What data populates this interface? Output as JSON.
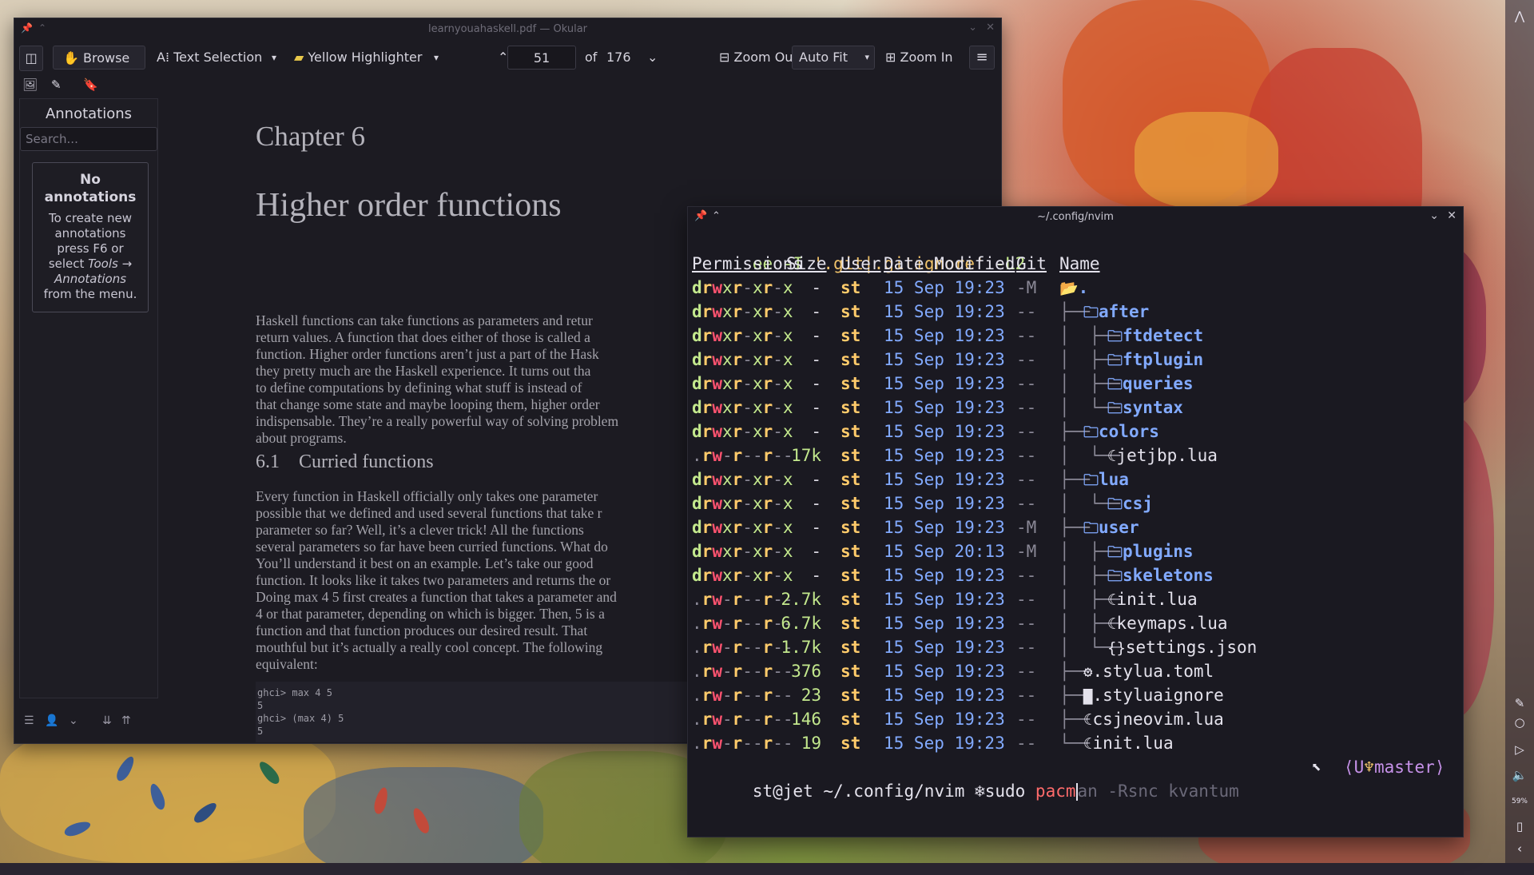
{
  "okular": {
    "title": "learnyouahaskell.pdf — Okular",
    "toolbar": {
      "browse": "Browse",
      "text_selection": "Text Selection",
      "highlighter": "Yellow Highlighter",
      "page_current": "51",
      "page_of": "of",
      "page_total": "176",
      "zoom_out": "Zoom Out",
      "zoom_mode": "Auto Fit",
      "zoom_in": "Zoom In"
    },
    "sidebar": {
      "heading": "Annotations",
      "search_placeholder": "Search...",
      "empty_title": "No annotations",
      "empty_line1": "To create new",
      "empty_line2": "annotations",
      "empty_line3": "press F6 or",
      "empty_line4_pre": "select ",
      "empty_line4_em": "Tools →",
      "empty_line5": "Annotations",
      "empty_line6": "from the menu."
    },
    "document": {
      "chapter": "Chapter 6",
      "title": "Higher order functions",
      "para1": [
        "Haskell functions can take functions as parameters and retur",
        "return values.  A function that does either of those is called a",
        "function. Higher order functions aren’t just a part of the Hask",
        "they pretty much are the Haskell experience.  It turns out tha",
        "to define computations by defining what stuff is instead of",
        "that change some state and maybe looping them, higher order",
        "indispensable. They’re a really powerful way of solving problem",
        "about programs."
      ],
      "section": "6.1    Curried functions",
      "para2": [
        "Every function in Haskell officially only takes one parameter",
        "possible that we defined and used several functions that take r",
        "parameter so far?  Well, it’s a clever trick!  All the functions",
        "several parameters so far have been curried functions.  What do",
        "You’ll understand it best on an example. Let’s take our good",
        "function. It looks like it takes two parameters and returns the or",
        "Doing max 4 5 first creates a function that takes a parameter and",
        "4 or that parameter, depending on which is bigger.  Then, 5 is a",
        "function and that function produces our desired result.  That",
        "mouthful but it’s actually a really cool concept.  The following",
        "equivalent:"
      ],
      "code": [
        "ghci> max 4 5",
        "5",
        "ghci> (max 4) 5",
        "5"
      ]
    }
  },
  "terminal": {
    "title": "~/.config/nvim",
    "command": {
      "prog": "ee",
      "flag1": "-I",
      "arg": "'.git|.gitignore'",
      "flag2": "-L2"
    },
    "headers": [
      "Permissions",
      "Size",
      "User",
      "Date Modified",
      "Git",
      "Name"
    ],
    "rows": [
      {
        "perm": "drwxr-xr-x",
        "size": "-",
        "user": "st",
        "date": "15 Sep 19:23",
        "git": "-M",
        "tree": "",
        "icon": "📂",
        "name": ".",
        "dir": true
      },
      {
        "perm": "drwxr-xr-x",
        "size": "-",
        "user": "st",
        "date": "15 Sep 19:23",
        "git": "--",
        "tree": "├──",
        "icon": "🗀",
        "name": "after",
        "dir": true
      },
      {
        "perm": "drwxr-xr-x",
        "size": "-",
        "user": "st",
        "date": "15 Sep 19:23",
        "git": "--",
        "tree": "│  ├──",
        "icon": "🗀",
        "name": "ftdetect",
        "dir": true
      },
      {
        "perm": "drwxr-xr-x",
        "size": "-",
        "user": "st",
        "date": "15 Sep 19:23",
        "git": "--",
        "tree": "│  ├──",
        "icon": "🗀",
        "name": "ftplugin",
        "dir": true
      },
      {
        "perm": "drwxr-xr-x",
        "size": "-",
        "user": "st",
        "date": "15 Sep 19:23",
        "git": "--",
        "tree": "│  ├──",
        "icon": "🗀",
        "name": "queries",
        "dir": true
      },
      {
        "perm": "drwxr-xr-x",
        "size": "-",
        "user": "st",
        "date": "15 Sep 19:23",
        "git": "--",
        "tree": "│  └──",
        "icon": "🗀",
        "name": "syntax",
        "dir": true
      },
      {
        "perm": "drwxr-xr-x",
        "size": "-",
        "user": "st",
        "date": "15 Sep 19:23",
        "git": "--",
        "tree": "├──",
        "icon": "🗀",
        "name": "colors",
        "dir": true
      },
      {
        "perm": ".rw-r--r--",
        "size": "17k",
        "user": "st",
        "date": "15 Sep 19:23",
        "git": "--",
        "tree": "│  └──",
        "icon": "☾",
        "name": "jetjbp.lua",
        "dir": false
      },
      {
        "perm": "drwxr-xr-x",
        "size": "-",
        "user": "st",
        "date": "15 Sep 19:23",
        "git": "--",
        "tree": "├──",
        "icon": "🗀",
        "name": "lua",
        "dir": true
      },
      {
        "perm": "drwxr-xr-x",
        "size": "-",
        "user": "st",
        "date": "15 Sep 19:23",
        "git": "--",
        "tree": "│  └──",
        "icon": "🗀",
        "name": "csj",
        "dir": true
      },
      {
        "perm": "drwxr-xr-x",
        "size": "-",
        "user": "st",
        "date": "15 Sep 19:23",
        "git": "-M",
        "tree": "├──",
        "icon": "🗀",
        "name": "user",
        "dir": true
      },
      {
        "perm": "drwxr-xr-x",
        "size": "-",
        "user": "st",
        "date": "15 Sep 20:13",
        "git": "-M",
        "tree": "│  ├──",
        "icon": "🗀",
        "name": "plugins",
        "dir": true
      },
      {
        "perm": "drwxr-xr-x",
        "size": "-",
        "user": "st",
        "date": "15 Sep 19:23",
        "git": "--",
        "tree": "│  ├──",
        "icon": "🗀",
        "name": "skeletons",
        "dir": true
      },
      {
        "perm": ".rw-r--r--",
        "size": "2.7k",
        "user": "st",
        "date": "15 Sep 19:23",
        "git": "--",
        "tree": "│  ├──",
        "icon": "☾",
        "name": "init.lua",
        "dir": false
      },
      {
        "perm": ".rw-r--r--",
        "size": "6.7k",
        "user": "st",
        "date": "15 Sep 19:23",
        "git": "--",
        "tree": "│  ├──",
        "icon": "☾",
        "name": "keymaps.lua",
        "dir": false
      },
      {
        "perm": ".rw-r--r--",
        "size": "1.7k",
        "user": "st",
        "date": "15 Sep 19:23",
        "git": "--",
        "tree": "│  └──",
        "icon": "{}",
        "name": "settings.json",
        "dir": false
      },
      {
        "perm": ".rw-r--r--",
        "size": "376",
        "user": "st",
        "date": "15 Sep 19:23",
        "git": "--",
        "tree": "├──",
        "icon": "⚙",
        "name": ".stylua.toml",
        "dir": false
      },
      {
        "perm": ".rw-r--r--",
        "size": "23",
        "user": "st",
        "date": "15 Sep 19:23",
        "git": "--",
        "tree": "├──",
        "icon": "▇",
        "name": ".styluaignore",
        "dir": false
      },
      {
        "perm": ".rw-r--r--",
        "size": "146",
        "user": "st",
        "date": "15 Sep 19:23",
        "git": "--",
        "tree": "├──",
        "icon": "☾",
        "name": "csjneovim.lua",
        "dir": false
      },
      {
        "perm": ".rw-r--r--",
        "size": "19",
        "user": "st",
        "date": "15 Sep 19:23",
        "git": "--",
        "tree": "└──",
        "icon": "☾",
        "name": "init.lua",
        "dir": false
      }
    ],
    "prompt": {
      "user_host": "st@jet",
      "cwd": "~/.config/nvim",
      "symbol": "❄",
      "typed_cmd": "sudo ",
      "typed_hl": "pacm",
      "ghost": "an -Rsnc kvantum",
      "git_prefix": "⟨U",
      "git_branch": "master⟩"
    }
  },
  "dock": {
    "battery": "59%"
  },
  "colors": {
    "accent_green": "#c3e88d",
    "accent_yellow": "#ffcb6b",
    "accent_blue": "#82aaff",
    "accent_purple": "#c792ea"
  }
}
